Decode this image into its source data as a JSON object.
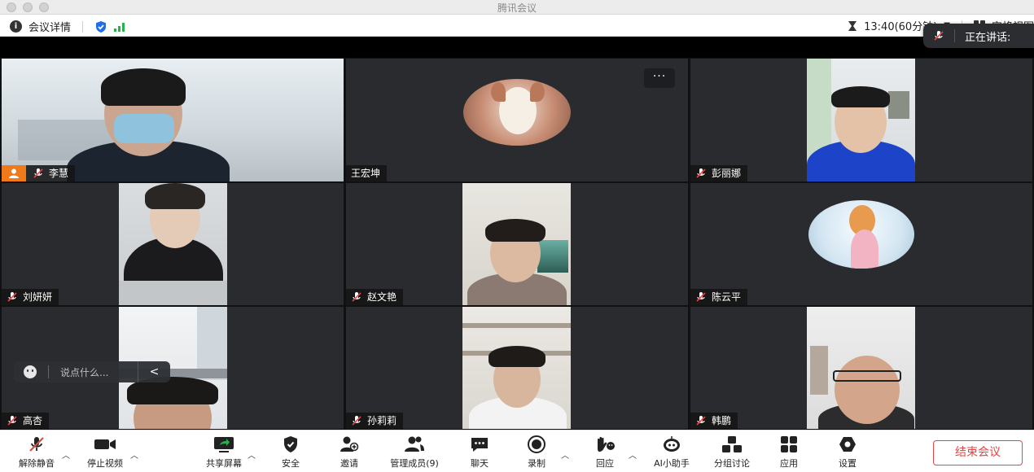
{
  "window": {
    "title": "腾讯会议"
  },
  "infobar": {
    "meeting_info": "会议详情",
    "timer": "13:40(60分钟)",
    "view_mode": "宫格视图"
  },
  "speaking": {
    "label": "正在讲话:"
  },
  "participants": [
    {
      "name": "李慧",
      "is_host": true,
      "muted": true
    },
    {
      "name": "王宏坤",
      "muted": false
    },
    {
      "name": "彭丽娜",
      "muted": true
    },
    {
      "name": "刘妍妍",
      "muted": true
    },
    {
      "name": "赵文艳",
      "muted": true
    },
    {
      "name": "陈云平",
      "muted": true
    },
    {
      "name": "高杏",
      "muted": true
    },
    {
      "name": "孙莉莉",
      "muted": true
    },
    {
      "name": "韩鹏",
      "muted": true
    }
  ],
  "tile_menu": {
    "more": "···"
  },
  "chat": {
    "placeholder": "说点什么...",
    "collapse": "<"
  },
  "toolbar": {
    "unmute": "解除静音",
    "stop_video": "停止视频",
    "share_screen": "共享屏幕",
    "security": "安全",
    "invite": "邀请",
    "manage_members": "管理成员(9)",
    "chat": "聊天",
    "record": "录制",
    "reactions": "回应",
    "ai_assistant": "AI小助手",
    "breakout": "分组讨论",
    "apps": "应用",
    "settings": "设置",
    "end_meeting": "结束会议"
  },
  "colors": {
    "host_badge": "#f07a1a",
    "end_red": "#e64545",
    "signal_green": "#2ab050",
    "shield_blue": "#1f6feb"
  }
}
